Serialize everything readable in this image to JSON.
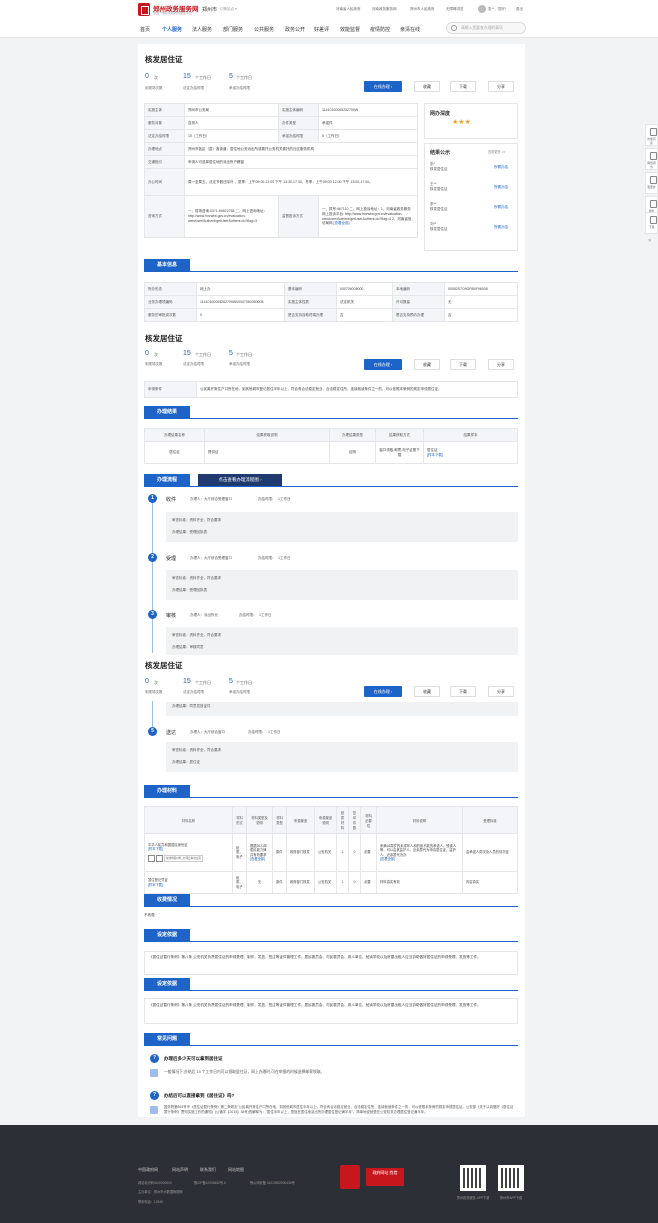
{
  "header": {
    "logo_title": "郑州政务服务网",
    "logo_subtitle": "全国一体化在线政务服务平台",
    "city": "郑州市",
    "city_switch": "切换站点 ▾",
    "links": [
      "河南省人民政府",
      "河南政务服务网",
      "郑州市人民政府",
      "无障碍浏览"
    ],
    "user": "张**，您好！",
    "logout": "退出",
    "search_placeholder": "请输入您要查办理的事项"
  },
  "nav": [
    "首页",
    "个人服务",
    "法人服务",
    "部门服务",
    "公共服务",
    "政务公开",
    "好差评",
    "效能监督",
    "疫情防控",
    "亲清在线"
  ],
  "item": {
    "title": "核发居住证",
    "stats": [
      {
        "num": "0",
        "unit": "次",
        "label": "到现场次数"
      },
      {
        "num": "15",
        "unit": "个工作日",
        "label": "法定办结时限"
      },
      {
        "num": "5",
        "unit": "个工作日",
        "label": "承诺办结时限"
      }
    ],
    "buttons": {
      "apply": "在线办理  ›",
      "favorite": "收藏",
      "download": "下载",
      "share": "分享"
    }
  },
  "info_table": {
    "rows": [
      [
        "实施主体",
        "郑州市公安局",
        "实施主体编码",
        "11410100005252709W"
      ],
      [
        "服务对象",
        "自然人",
        "办件类型",
        "承诺件"
      ],
      [
        "法定办结时限",
        "15（工作日）",
        "承诺办结时限",
        "5（工作日）"
      ]
    ],
    "location_k": "办理地点",
    "location_v": "郑州市各区（县）各街道，居住地公安派出所或委托公安机关委托的社区服务机构",
    "flow_k": "交通指引",
    "flow_v": "申请人可选择居住地的派出所户籍窗",
    "time_k": "办公时间",
    "time_v": "周一至周五，法定节假日除外 ，夏季：上午09:00-12:00 下午 13:30-17:30，冬季：上午09:00-12:00 下午 13:00-17:00。",
    "consult_k": "咨询方式",
    "consult_v": "一、现场咨询:0371-69622765 二、网上咨询地址：http://www.hnzwfw.gov.cn/evaluation-web/user/Authent/getUserAuthent.do?flag=3",
    "supervise_k": "监督投诉方式",
    "supervise_v": "一、拨号:967110 二、网上投诉地址：1、河南省政务服务网上投诉平台: http://www.hnzwfw.gov.cn/evaluation-web/user/Authent/getUserAuthent.do?flag=4 2、河南省信访局网",
    "more": "[查看全部]"
  },
  "satisfaction": {
    "title": "网办深度",
    "stars": "★★★"
  },
  "results": {
    "title": "结果公示",
    "more": "查看更多 >>",
    "items": [
      {
        "name": "张*",
        "sub": "核发居住证",
        "status": "所需办结"
      },
      {
        "name": "王**",
        "sub": "核发居住证",
        "status": "所需办结"
      },
      {
        "name": "李**",
        "sub": "核发居住证",
        "status": "所需办结"
      },
      {
        "name": "刘**",
        "sub": "核发居住证",
        "status": "所需办结"
      }
    ]
  },
  "basic": {
    "tag": "基本信息",
    "rows": [
      [
        "所办形态",
        "网上办",
        "基本编码",
        "000706005000",
        "本地编码",
        "00052S7O9GR80F96008"
      ],
      [
        "业务办理项编码",
        "11410100005262709W00007060050008",
        "实施主体性质",
        "法定机关",
        "许可数量",
        "无"
      ],
      [
        "服务的审批或次数",
        "0",
        "是否支持自助终端办理",
        "否",
        "是否支持预约办理",
        "否"
      ]
    ]
  },
  "condition": {
    "k": "申请条件",
    "v": "公民离开常住户口所在地，到其他城市登记居住半年以上，符合有合法稳定就业、合法稳定住所、连续就读条件之一的，可以依照本条例的规定申领居住证。"
  },
  "result_sec": {
    "tag": "办理结果",
    "headers": [
      "办理结果名称",
      "结果获取说明",
      "办理结果类型",
      "结果获取方式",
      "结果样本"
    ],
    "row": [
      "居住证",
      "提供证",
      "证明",
      "窗口领取,邮寄,电子证照下载",
      "居住证",
      "[样本下载]"
    ]
  },
  "flow": {
    "tag": "办理流程",
    "tag2": "点击查看办理流程图  ›",
    "steps": [
      {
        "n": "1",
        "name": "收件",
        "handler": "办理人：大厅综合受理窗口",
        "time_lbl": "办结时限：",
        "time": "1工作日",
        "std": "审查标准：资料齐全，符合要求",
        "res": "办理结果：受理回执表"
      },
      {
        "n": "2",
        "name": "受理",
        "handler": "办理人：大厅综合受理窗口",
        "time_lbl": "办结时限：",
        "time": "1工作日",
        "std": "审查标准：资料齐全，符合要求",
        "res": "办理结果：受理回执表"
      },
      {
        "n": "3",
        "name": "审核",
        "handler": "办理人：派出所长",
        "time_lbl": "办结时限：",
        "time": "1工作日",
        "std": "审查标准：资料齐全，符合要求",
        "res": "办理结果：审核同意"
      },
      {
        "n": "5",
        "name": "送达",
        "handler": "办理人：大厅综合窗口",
        "time_lbl": "办结时限：",
        "time": "1工作日",
        "std": "审查标准：资料齐全，符合要求",
        "res": "办理结果：居住证"
      }
    ],
    "partial": "办理结果：同意发放证件"
  },
  "materials": {
    "tag": "办理材料",
    "headers": [
      "材料名称",
      "材料形式",
      "材料类型及说明",
      "材料类型",
      "来源渠道",
      "来源渠道说明",
      "纸质材料",
      "复印件数",
      "材料必要性",
      "材料说明",
      "受理标准"
    ],
    "r1": {
      "name": "中华人民共和国居民身份证",
      "dl": "[样本下载]",
      "form": "纸质、电子",
      "desc": "根据2021年居民能力律并有效要求",
      "more": "[查看全部]",
      "type": "原件",
      "src": "政府部门核发",
      "srcd": "公安机关",
      "paper": "1",
      "copy": "0",
      "need": "必要",
      "note": "来满16周岁的未成年人和的依不能的承诺人，残疾人等，可以由其监护人、近亲属代为申请居住证。监护人、近亲属代为办",
      "note_more": "[查看全部]",
      "std": "由承诺人同次及人员的情况证"
    },
    "r1_btns": [
      "在线申报材料_办理定事迹证需"
    ],
    "r2": {
      "name": "暂住登记凭证",
      "dl": "[样本下载]",
      "form": "纸质、电子",
      "desc": "无",
      "type": "原件",
      "src": "政府部门核发",
      "srcd": "公安机关",
      "paper": "1",
      "copy": "0",
      "need": "必要",
      "note": "材料真实有效",
      "std": "内容真实"
    }
  },
  "fee": {
    "tag": "收费情况",
    "v": "不收费"
  },
  "basis1": {
    "tag": "设定依据",
    "v": "《居住证暂行条例》第八条 公安机关负责居住证的申领受理、制作、发放、签注等证件管理工作。居民委员会、村民委员会、用人单位、就读学校以及房屋出租人应当协助做好居住证的申领受理、发放等工作。"
  },
  "basis2": {
    "tag": "设定依据",
    "v": "《居住证暂行条例》第八条 公安机关负责居住证的申领受理、制作、发放、签注等证件管理工作。居民委员会、村民委员会、用人单位、就读学校以及房屋出租人应当协助做好居住证的申领受理、发放等工作。"
  },
  "faq": {
    "tag": "常见问题",
    "items": [
      {
        "q": "办理后多少天可以拿到居住证",
        "a": "一般情况下,办结后 15 个工作日内可以领取居住证，网上办理时,可在申报的时候选择邮寄领取。"
      },
      {
        "q": "办结后可以直接拿到《居住证》吗?",
        "a": "国务院第663号令《居住证暂行条例》第二条规定\"公民离开常住户口所在地，到其他城市居住半年以上，符合有合法稳定就业、合法稳定住所、连续就读条件之一的，可以依照本条例的规定申领居住证。公安部《关于认真做好《居住证暂行条例》贯彻实施工作的通知》(公通字【2015】38号)的解释为：\"居住半年以上，是指在居住地派出所办理居住登记满半年\"。简单地说就是在公安机关办理居住登记满半年。"
      }
    ]
  },
  "sidebar": [
    "智能问答",
    "网络调查",
    "我要办",
    "我的",
    "下载"
  ],
  "footer": {
    "links": [
      "中国政府网",
      "网站声明",
      "联系我们",
      "网站地图"
    ],
    "l1": "网站标识码4100000004",
    "l2": "豫ICP备10005452号-6",
    "l3": "豫公网安备 41010502000430号",
    "l4": "主办单位：郑州市大数据管理局",
    "l5": "联系电话：12345",
    "badge": "政府网站 找错",
    "qr1": "郑州政务服务 APP下载",
    "qr2": "郑州市APP下载"
  }
}
